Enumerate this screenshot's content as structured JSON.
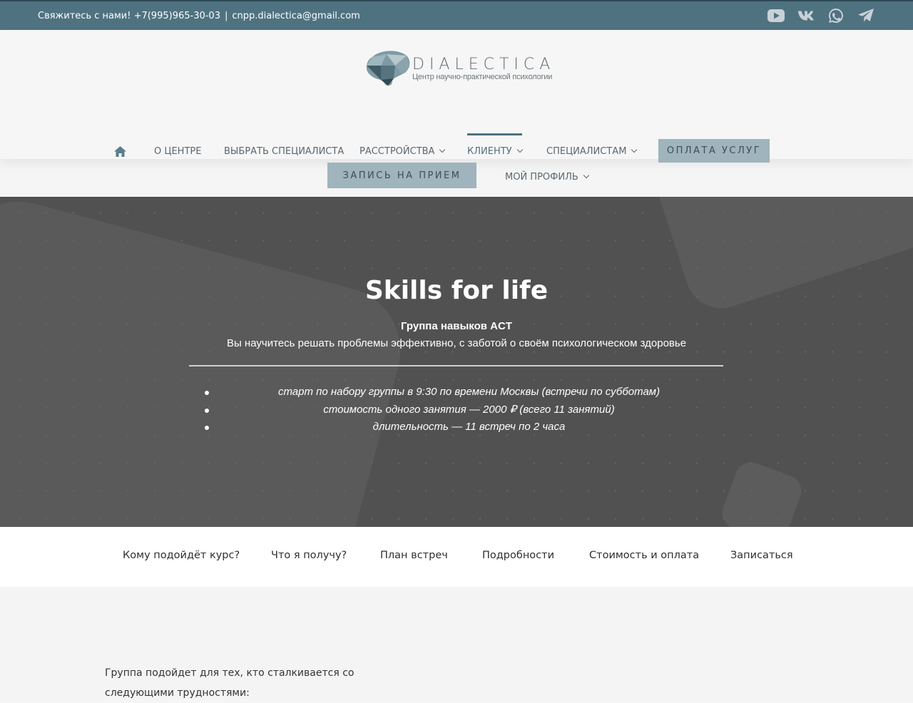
{
  "topbar": {
    "contact_text": "Свяжитесь с нами! +7(995)965-30-03",
    "separator": "|",
    "email": "cnpp.dialectica@gmail.com",
    "social_icons": [
      "youtube-icon",
      "vk-icon",
      "whatsapp-icon",
      "telegram-icon"
    ]
  },
  "logo": {
    "name": "DIALECTICA",
    "subtitle": "Центр научно-практической психологии"
  },
  "nav": {
    "home_icon": "home-icon",
    "items": [
      {
        "label": "О ЦЕНТРЕ"
      },
      {
        "label": "ВЫБРАТЬ СПЕЦИАЛИСТА"
      },
      {
        "label": "РАССТРОЙСТВА"
      },
      {
        "label": "КЛИЕНТУ"
      },
      {
        "label": "СПЕЦИАЛИСТАМ"
      }
    ],
    "pay_button": "ОПЛАТА УСЛУГ",
    "appointment_button": "ЗАПИСЬ НА ПРИЕМ",
    "profile": "МОЙ ПРОФИЛЬ"
  },
  "hero": {
    "title": "Skills for life",
    "subtitle": "Группа навыков ACT",
    "description": "Вы научитесь решать проблемы эффективно, с заботой о своём психологическом здоровье",
    "bullets": [
      "старт по набору группы в 9:30 по времени Москвы (встречи по субботам)",
      "стоимость одного занятия — 2000 ₽ (всего 11 занятий)",
      "длительность — 11 встреч по 2 часа"
    ]
  },
  "subnav": {
    "items": [
      "Кому подойдёт курс?",
      "Что я получу?",
      "План встреч",
      "Подробности",
      "Стоимость и оплата",
      "Записаться"
    ]
  },
  "content": {
    "intro": "Группа подойдет для тех, кто сталкивается со следующими трудностями:"
  },
  "colors": {
    "topbar": "#4f7281",
    "accent_button": "#9fb4bc",
    "hero_bg": "#515151"
  }
}
